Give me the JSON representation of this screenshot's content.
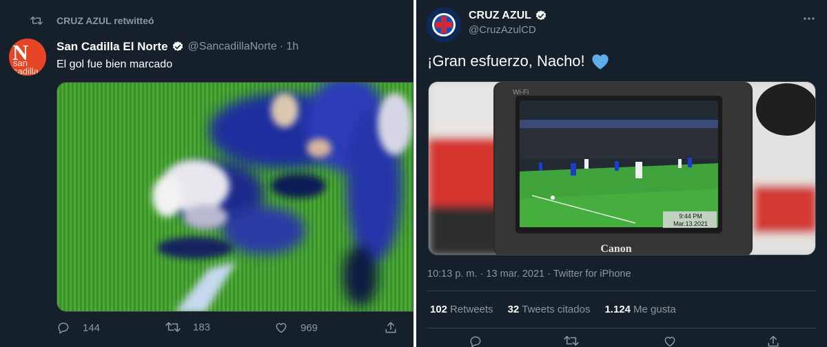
{
  "colors": {
    "background": "#15202b",
    "text_primary": "#ffffff",
    "text_secondary": "#8899a6",
    "verified": "#1da1f2",
    "heart_emoji": "#5dadec"
  },
  "left_tweet": {
    "retweet_context": "CRUZ AZUL retwitteó",
    "author": {
      "name": "San Cadilla El Norte",
      "handle": "@SancadillaNorte",
      "time": "· 1h",
      "avatar_letter": "N",
      "avatar_text_line1": "san",
      "avatar_text_line2": "cadilla"
    },
    "text": "El gol fue bien marcado",
    "actions": {
      "replies": "144",
      "retweets": "183",
      "likes": "969"
    }
  },
  "right_tweet": {
    "author": {
      "name": "CRUZ AZUL",
      "handle": "@CruzAzulCD"
    },
    "text": "¡Gran esfuerzo, Nacho!",
    "emoji": "blue-heart",
    "photo_overlay": {
      "camera_brand": "Canon",
      "camera_label": "Wi-Fi",
      "screen_time": "9:44 PM",
      "screen_date": "Mar.13.2021"
    },
    "meta": "10:13 p. m. · 13 mar. 2021 · Twitter for iPhone",
    "stats": [
      {
        "count": "102",
        "label": "Retweets"
      },
      {
        "count": "32",
        "label": "Tweets citados"
      },
      {
        "count": "1.124",
        "label": "Me gusta"
      }
    ]
  }
}
